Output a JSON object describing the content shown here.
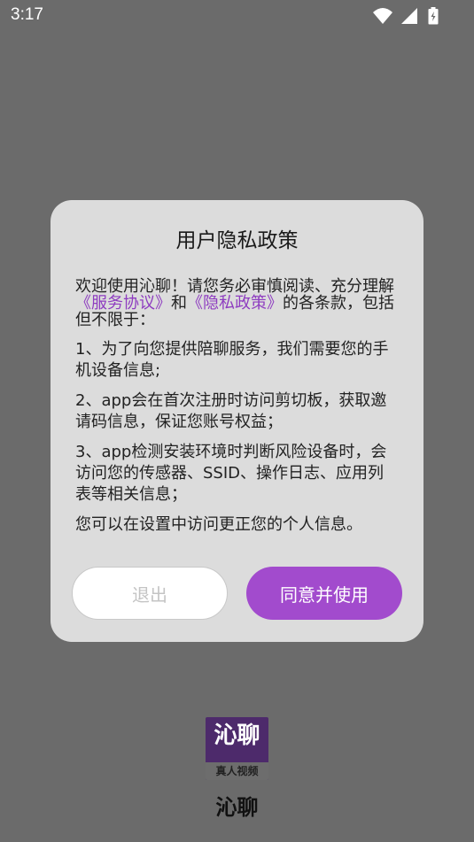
{
  "status_bar": {
    "time": "3:17",
    "icons": [
      "wifi-icon",
      "cell-signal-icon",
      "battery-icon"
    ]
  },
  "dialog": {
    "title": "用户隐私政策",
    "intro_prefix": "欢迎使用沁聊！请您务必审慎阅读、充分理解",
    "link_service": "《服务协议》",
    "intro_mid": "和",
    "link_privacy": "《隐私政策》",
    "intro_suffix": "的各条款，包括但不限于：",
    "item1": "1、为了向您提供陪聊服务，我们需要您的手机设备信息;",
    "item2": "2、app会在首次注册时访问剪切板，获取邀请码信息，保证您账号权益；",
    "item3": "3、app检测安装环境时判断风险设备时，会访问您的传感器、SSID、操作日志、应用列表等相关信息；",
    "outro": "您可以在设置中访问更正您的个人信息。",
    "exit_label": "退出",
    "agree_label": "同意并使用"
  },
  "brand": {
    "logo_title": "沁聊",
    "logo_subtitle": "真人视频",
    "name": "沁聊"
  },
  "colors": {
    "overlay": "#6b6b6b",
    "dialog_bg": "#dcdcdc",
    "accent": "#a24bcd",
    "link": "#8e3cc0"
  }
}
